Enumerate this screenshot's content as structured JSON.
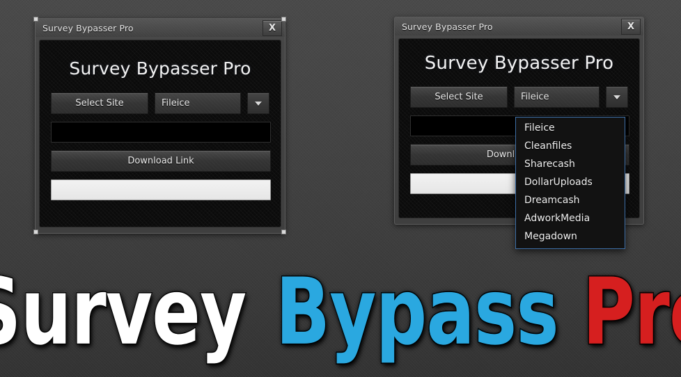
{
  "window_left": {
    "titlebar": {
      "title": "Survey Bypasser Pro",
      "close_label": "X"
    },
    "heading": "Survey Bypasser Pro",
    "select_site_button": "Select Site",
    "combo_value": "Fileice",
    "download_button": "Download Link",
    "url_field_value": "",
    "result_field_value": ""
  },
  "window_right": {
    "titlebar": {
      "title": "Survey Bypasser Pro",
      "close_label": "X"
    },
    "heading": "Survey Bypasser Pro",
    "select_site_button": "Select Site",
    "combo_value": "Fileice",
    "download_button": "Download Link",
    "url_field_value": "",
    "result_field_value": "",
    "dropdown": {
      "open": true,
      "selected": "Fileice",
      "options": [
        "Fileice",
        "Cleanfiles",
        "Sharecash",
        "DollarUploads",
        "Dreamcash",
        "AdworkMedia",
        "Megadown"
      ]
    }
  },
  "banner": {
    "word1": "Survey",
    "word2": "Bypass",
    "word3": "Pro"
  },
  "colors": {
    "desktop_background": "#434343",
    "panel_background": "#0b0b0b",
    "button_face": "#383838",
    "dropdown_border": "#3d6fa8",
    "dropdown_background": "#121212",
    "banner_word1": "#ffffff",
    "banner_word2": "#2aa8e0",
    "banner_word3": "#d61f1f",
    "result_field": "#eeeeee",
    "url_field": "#000000"
  },
  "icons": {
    "close": "close-icon",
    "dropdown_caret": "chevron-down-icon"
  }
}
